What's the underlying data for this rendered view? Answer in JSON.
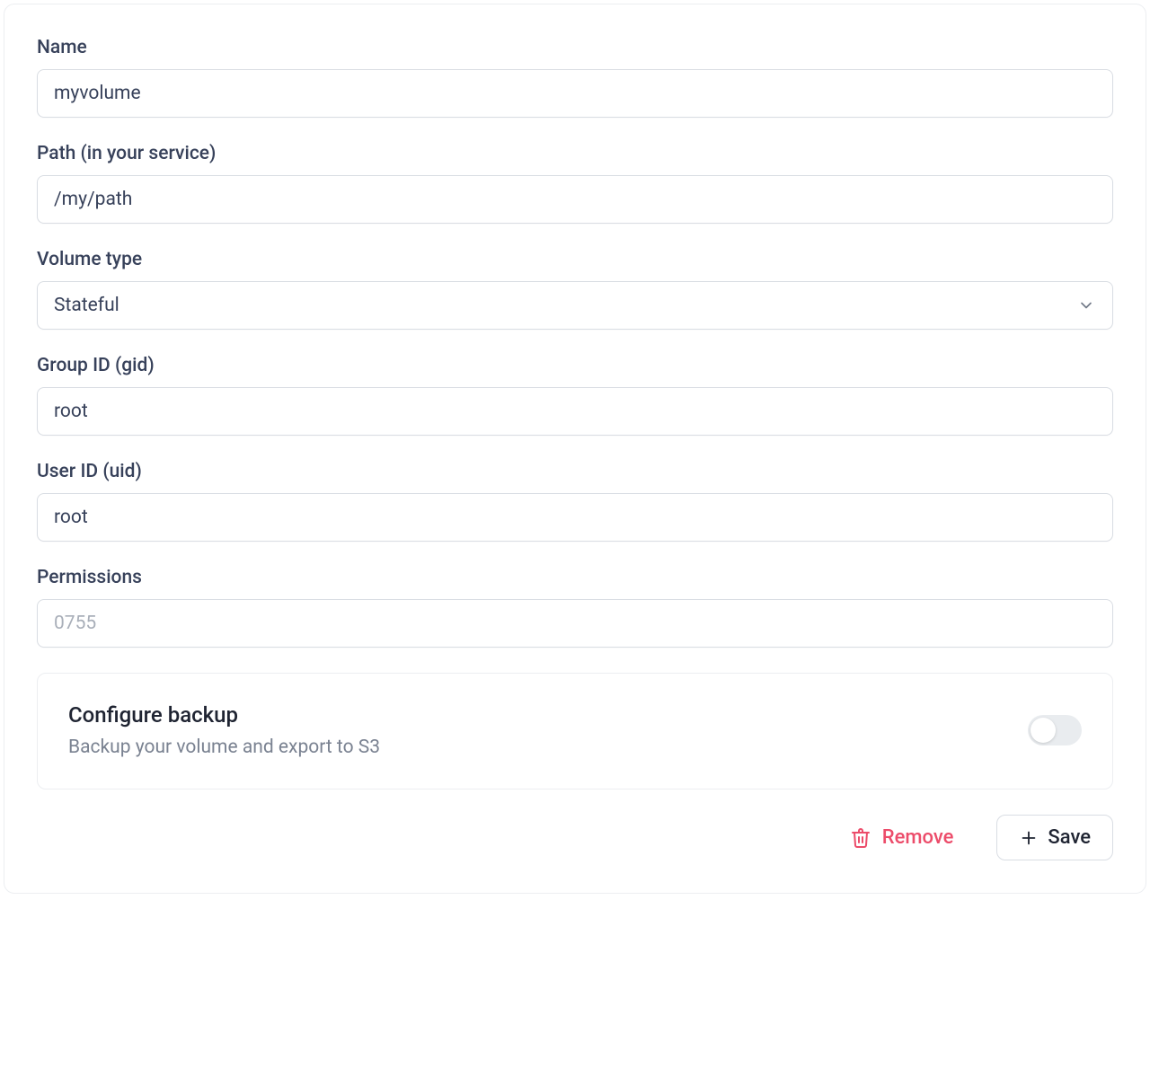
{
  "fields": {
    "name": {
      "label": "Name",
      "value": "myvolume"
    },
    "path": {
      "label": "Path (in your service)",
      "value": "/my/path"
    },
    "volume_type": {
      "label": "Volume type",
      "value": "Stateful"
    },
    "gid": {
      "label": "Group ID (gid)",
      "value": "root"
    },
    "uid": {
      "label": "User ID (uid)",
      "value": "root"
    },
    "permissions": {
      "label": "Permissions",
      "placeholder": "0755",
      "value": ""
    }
  },
  "backup": {
    "title": "Configure backup",
    "subtitle": "Backup your volume and export to S3",
    "enabled": false
  },
  "actions": {
    "remove": "Remove",
    "save": "Save"
  }
}
